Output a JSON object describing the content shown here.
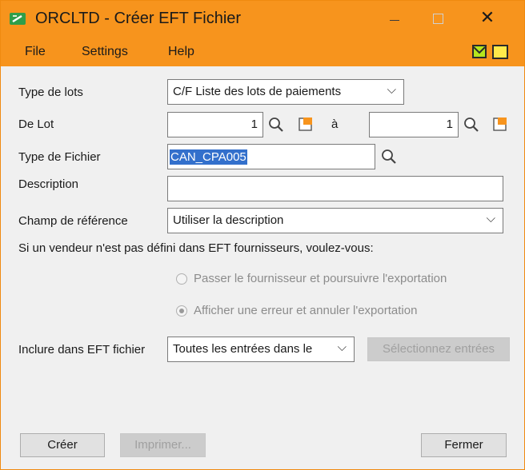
{
  "window": {
    "title": "ORCLTD - Créer EFT Fichier",
    "close_glyph": "✕"
  },
  "menu": {
    "items": [
      "File",
      "Settings",
      "Help"
    ]
  },
  "form": {
    "type_lots_label": "Type de lots",
    "type_lots_value": "C/F Liste des lots de paiements",
    "de_lot_label": "De Lot",
    "de_lot_from": "1",
    "a_label": "à",
    "de_lot_to": "1",
    "type_fichier_label": "Type de Fichier",
    "type_fichier_value": "CAN_CPA005",
    "description_label": "Description",
    "description_value": "",
    "champ_ref_label": "Champ de référence",
    "champ_ref_value": "Utiliser la description",
    "vendor_question": "Si un vendeur n'est pas défini dans EFT fournisseurs, voulez-vous:",
    "radio_options": [
      {
        "label": "Passer le fournisseur et poursuivre l'exportation",
        "checked": false
      },
      {
        "label": "Afficher une erreur et annuler l'exportation",
        "checked": true
      }
    ],
    "inclure_label": "Inclure dans EFT fichier",
    "inclure_value": "Toutes les entrées dans le",
    "select_entries_label": "Sélectionnez entrées"
  },
  "buttons": {
    "creer": "Créer",
    "imprimer": "Imprimer...",
    "fermer": "Fermer"
  },
  "colors": {
    "titlebar": "#f7941d",
    "selection": "#3370cc"
  },
  "icons": {
    "chevron": "⌵"
  }
}
